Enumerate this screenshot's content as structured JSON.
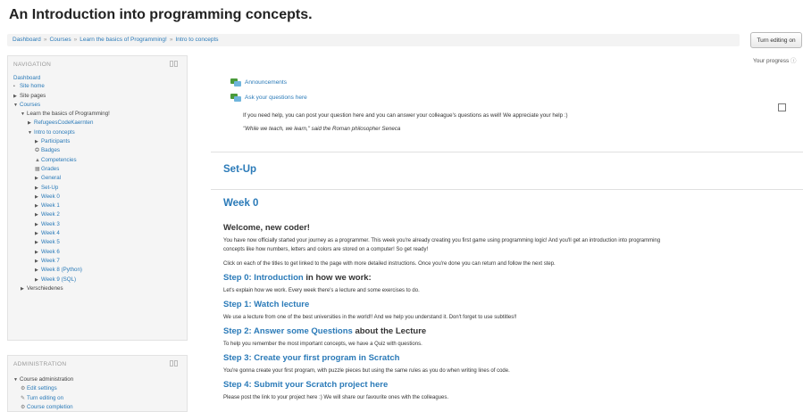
{
  "page": {
    "title": "An Introduction into programming concepts."
  },
  "breadcrumb": [
    "Dashboard",
    "Courses",
    "Learn the basics of Programming!",
    "Intro to concepts"
  ],
  "breadcrumb_sep": "»",
  "header": {
    "turn_editing": "Turn editing on",
    "your_progress": "Your progress"
  },
  "navigation": {
    "title": "NAVIGATION",
    "items": [
      "Dashboard",
      "Site home",
      "Site pages",
      "Courses",
      "Learn the basics of Programming!",
      "RefugeesCodeKaernten",
      "Intro to concepts",
      "Participants",
      "Badges",
      "Competencies",
      "Grades",
      "General",
      "Set-Up",
      "Week 0",
      "Week 1",
      "Week 2",
      "Week 3",
      "Week 4",
      "Week 5",
      "Week 6",
      "Week 7",
      "Week 8 (Python)",
      "Week 9 (SQL)",
      "Verschiedenes"
    ]
  },
  "administration": {
    "title": "ADMINISTRATION",
    "items": [
      "Course administration",
      "Edit settings",
      "Turn editing on",
      "Course completion"
    ]
  },
  "section0": {
    "announcements": "Announcements",
    "ask_questions": "Ask your questions here",
    "help_text": "If you need help, you can post your question here and you can answer your colleague's questions as well! We appreciate your help :)",
    "quote": "\"While we teach, we learn,\" said the Roman philosopher Seneca"
  },
  "setup": {
    "title": "Set-Up"
  },
  "week0": {
    "title": "Week 0",
    "welcome": "Welcome, new coder!",
    "intro_line1": "You have now officially started your journey as a programmer. This week you're already creating you first game using programming logic! And you'll get an introduction into programming",
    "intro_line2": "concepts like how numbers, letters and colors are stored on a computer! So get ready!",
    "click_text": "Click on each of the titles to get linked to the page with more detailed instructions. Once you're done you can return and follow the next step.",
    "steps": [
      {
        "link": "Step 0: Introduction",
        "rest": " in how we work:",
        "desc": "Let's explain how we work. Every week there's a lecture and some exercises to do."
      },
      {
        "link": "Step 1: Watch lecture",
        "rest": "",
        "desc": "We use a lecture from one of the best universities in the world!! And we help you understand it. Don't forget to use subtitles!!"
      },
      {
        "link": "Step 2: Answer some Questions",
        "rest": " about the Lecture",
        "desc": "To help you remember the most important concepts, we have a Quiz with questions."
      },
      {
        "link": "Step 3: Create your first program in Scratch",
        "rest": "",
        "desc": "You're gonna create your first program, with puzzle pieces but using the same rules as you do when writing lines of code."
      },
      {
        "link": "Step 4: Submit your Scratch project here",
        "rest": "",
        "desc": "Please post the link to your project here :) We will share our favourite ones with the colleagues."
      }
    ]
  }
}
